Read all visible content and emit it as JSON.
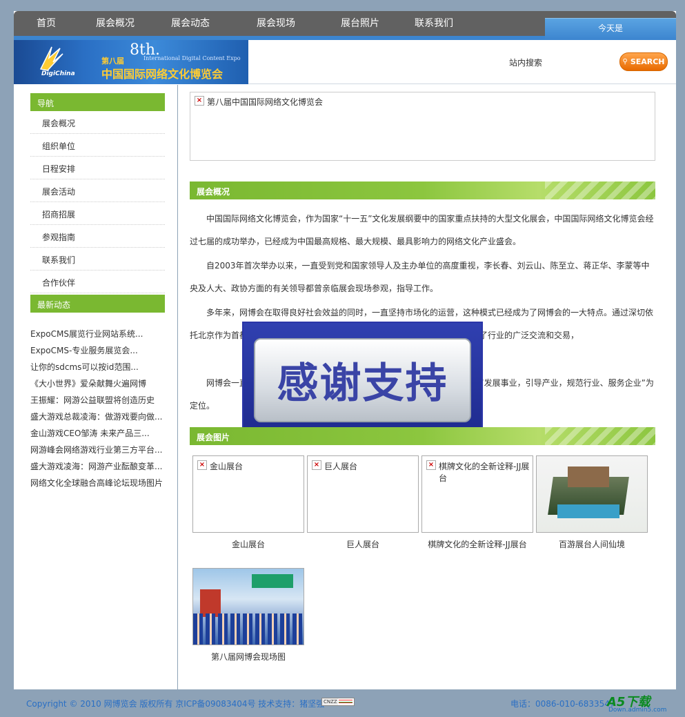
{
  "topnav": {
    "items": [
      "首页",
      "展会概况",
      "展会动态",
      "展会现场",
      "展台照片",
      "联系我们"
    ],
    "today_label": "今天是"
  },
  "header": {
    "banner": {
      "brand": "DigiChina",
      "edition": "第八届",
      "eighth": "8th.",
      "english": "International Digital Content Expo",
      "chinese": "中国国际网络文化博览会"
    },
    "search_label": "站内搜索",
    "search_button": "SEARCH"
  },
  "sidebar": {
    "nav_title": "导航",
    "nav_items": [
      "展会概况",
      "组织单位",
      "日程安排",
      "展会活动",
      "招商招展",
      "参观指南",
      "联系我们",
      "合作伙伴"
    ],
    "news_title": "最新动态",
    "news_items": [
      "ExpoCMS展览行业网站系统...",
      "ExpoCMS-专业服务展览会...",
      "让你的sdcms可以按id范围...",
      "《大小世界》爱朵献舞火遍网博",
      "王振耀：网游公益联盟将创造历史",
      "盛大游戏总裁凌海：做游戏要向做...",
      "金山游戏CEO邹涛 未来产品三...",
      "网游峰会网络游戏行业第三方平台...",
      "盛大游戏凌海：网游产业酝酿变革...",
      "网络文化全球融合高峰论坛现场图片"
    ]
  },
  "main": {
    "top_image_alt": "第八届中国国际网络文化博览会",
    "overview_title": "展会概况",
    "paragraphs": [
      "中国国际网络文化博览会，作为国家“十一五”文化发展纲要中的国家重点扶持的大型文化展会，中国国际网络文化博览会经过七届的成功举办，已经成为中国最高规格、最大规模、最具影响力的网络文化产业盛会。",
      "自2003年首次举办以来，一直受到党和国家领导人及主办单位的高度重视，李长春、刘云山、陈至立、蒋正华、李蒙等中央及人大、政协方面的有关领导都曾亲临展会现场参观，指导工作。",
      "多年来，网博会在取得良好社会效益的同时，一直坚持市场化的运营，这种模式已经成为了网博会的一大特点。通过深切依托北京作为首都的区位优势，以高品质的服务，大大调动了企业的参与性，促进了行业的广泛交流和交易，",
      "网博会一直坚持以“发展事业，引导产业，规范行业，服务企业”为宗旨，以“发展事业，引导产业，规范行业、服务企业”为定位。"
    ],
    "overlay_text": "感谢支持",
    "photos_title": "展会图片",
    "gallery": [
      {
        "alt": "金山展台",
        "caption": "金山展台"
      },
      {
        "alt": "巨人展台",
        "caption": "巨人展台"
      },
      {
        "alt": "棋牌文化的全新诠释-JJ展台",
        "caption": "棋牌文化的全新诠释-JJ展台"
      },
      {
        "alt": "",
        "caption": "百游展台人间仙境"
      },
      {
        "alt": "",
        "caption": "第八届网博会现场图"
      }
    ]
  },
  "footer": {
    "copyright": "Copyright © 2010 网博览会  版权所有  京ICP备09083404号  技术支持：猪坚强",
    "cnzz": "CNZZ",
    "tel": "电话：0086-010-6833547",
    "watermark": "A5下载",
    "watermark_sub": "Down.admin5.com"
  },
  "colors": {
    "accent_green": "#7ab831",
    "nav_gray": "#616161",
    "link_blue": "#2a6fc4",
    "page_bg": "#8da2b7"
  }
}
